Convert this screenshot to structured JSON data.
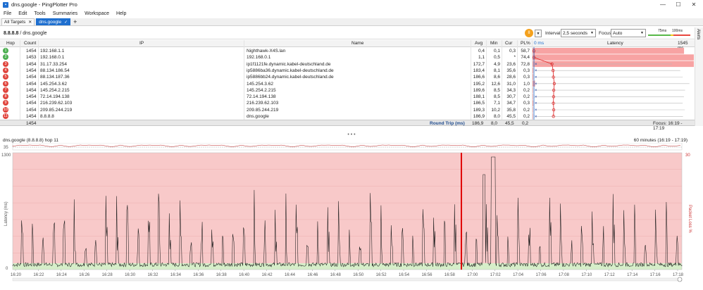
{
  "window": {
    "title": "dns.google - PingPlotter Pro",
    "minimize": "—",
    "maximize": "☐",
    "close": "✕"
  },
  "menu": [
    "File",
    "Edit",
    "Tools",
    "Summaries",
    "Workspace",
    "Help"
  ],
  "tabs": [
    {
      "label": "All Targets",
      "close": "✕"
    },
    {
      "label": "dns.google",
      "close": "✓"
    }
  ],
  "tab_add": "+",
  "toolbar": {
    "breadcrumb_ip": "8.8.8.8",
    "breadcrumb_sep": " / ",
    "breadcrumb_host": "dns.google",
    "pause_icon": "pause-icon",
    "pause_glyph": "II",
    "dropdown_glyph": "▼",
    "interval_label": "Interval",
    "interval_value": "2,5 seconds",
    "focus_label": "Focus",
    "focus_value": "Auto",
    "legend_75": "75ms",
    "legend_100": "100ms",
    "colors": {
      "green": "#58b848",
      "yellow": "#f2c71b",
      "red": "#e8463d"
    }
  },
  "alerts_label": "Alerts",
  "table": {
    "headers": {
      "hop": "Hop",
      "count": "Count",
      "ip": "IP",
      "name": "Name",
      "avg": "Avg",
      "min": "Min",
      "cur": "Cur",
      "pl": "PL%",
      "lat_left": "0 ms",
      "latency": "Latency",
      "lat_right": "1545 ms"
    },
    "rows": [
      {
        "hop": "1",
        "count": "1454",
        "ip": "192.168.1.1",
        "name": "Nighthawk-X4S.lan",
        "avg": "0,4",
        "min": "0,1",
        "cur": "0,3",
        "pl": "58,7",
        "color": "#4caf50",
        "plf": 0.587,
        "avg_ms": 0.4
      },
      {
        "hop": "2",
        "count": "1453",
        "ip": "192.168.0.1",
        "name": "192.168.0.1",
        "avg": "1,1",
        "min": "0,5",
        "cur": "*",
        "pl": "74,4",
        "color": "#4caf50",
        "plf": 0.744,
        "avg_ms": 1.1
      },
      {
        "hop": "3",
        "count": "1454",
        "ip": "31.17.33.254",
        "name": "ip1f1121fe.dynamic.kabel-deutschland.de",
        "avg": "172,7",
        "min": "4,9",
        "cur": "23,6",
        "pl": "72,8",
        "color": "#e0443c",
        "plf": 0.728,
        "avg_ms": 172.7
      },
      {
        "hop": "4",
        "count": "1454",
        "ip": "88.134.186.54",
        "name": "ip5886ba36.dynamic.kabel-deutschland.de",
        "avg": "183,4",
        "min": "8,1",
        "cur": "35,6",
        "pl": "0,3",
        "color": "#e0443c",
        "plf": 0.003,
        "avg_ms": 183.4
      },
      {
        "hop": "5",
        "count": "1454",
        "ip": "88.134.187.36",
        "name": "ip5886bb24.dynamic.kabel-deutschland.de",
        "avg": "186,6",
        "min": "8,6",
        "cur": "28,6",
        "pl": "0,3",
        "color": "#e0443c",
        "plf": 0.003,
        "avg_ms": 186.6
      },
      {
        "hop": "6",
        "count": "1454",
        "ip": "145.254.3.62",
        "name": "145.254.3.62",
        "avg": "195,2",
        "min": "12,6",
        "cur": "31,0",
        "pl": "1,0",
        "color": "#e0443c",
        "plf": 0.01,
        "avg_ms": 195.2
      },
      {
        "hop": "7",
        "count": "1454",
        "ip": "145.254.2.215",
        "name": "145.254.2.215",
        "avg": "189,6",
        "min": "8,5",
        "cur": "34,3",
        "pl": "0,2",
        "color": "#e0443c",
        "plf": 0.002,
        "avg_ms": 189.6
      },
      {
        "hop": "8",
        "count": "1454",
        "ip": "72.14.194.138",
        "name": "72.14.194.138",
        "avg": "188,1",
        "min": "8,5",
        "cur": "30,7",
        "pl": "0,2",
        "color": "#e0443c",
        "plf": 0.002,
        "avg_ms": 188.1
      },
      {
        "hop": "9",
        "count": "1454",
        "ip": "216.239.62.103",
        "name": "216.239.62.103",
        "avg": "186,5",
        "min": "7,1",
        "cur": "34,7",
        "pl": "0,3",
        "color": "#e0443c",
        "plf": 0.003,
        "avg_ms": 186.5
      },
      {
        "hop": "10",
        "count": "1454",
        "ip": "209.85.244.219",
        "name": "209.85.244.219",
        "avg": "189,3",
        "min": "10,2",
        "cur": "35,8",
        "pl": "0,2",
        "color": "#e0443c",
        "plf": 0.002,
        "avg_ms": 189.3
      },
      {
        "hop": "11",
        "count": "1454",
        "ip": "8.8.8.8",
        "name": "dns.google",
        "avg": "186,9",
        "min": "8,0",
        "cur": "45,5",
        "pl": "0,2",
        "color": "#e0443c",
        "plf": 0.002,
        "avg_ms": 186.9
      }
    ],
    "summary": {
      "count": "1454",
      "label": "Round Trip (ms)",
      "avg": "186,9",
      "min": "8,0",
      "cur": "45,5",
      "pl": "0,2",
      "focus": "Focus: 16:19 - 17:19"
    }
  },
  "splitter_glyph": "• • •",
  "graph": {
    "title": "dns.google (8.8.8.8) hop 11",
    "range": "60 minutes (16:19 - 17:19)",
    "mini_axis": "35",
    "y_max": "1300",
    "y_min": "0",
    "y_label": "Latency (ms)",
    "pl_max": "30",
    "pl_label": "Packet Loss %",
    "x_ticks": [
      "16:20",
      "16:22",
      "16:24",
      "16:26",
      "16:28",
      "16:30",
      "16:32",
      "16:34",
      "16:36",
      "16:38",
      "16:40",
      "16:42",
      "16:44",
      "16:46",
      "16:48",
      "16:50",
      "16:52",
      "16:54",
      "16:56",
      "16:58",
      "17:00",
      "17:02",
      "17:04",
      "17:06",
      "17:08",
      "17:10",
      "17:12",
      "17:14",
      "17:16",
      "17:18"
    ],
    "marker_time": "17:00",
    "colors": {
      "bad": "#f8c9c9",
      "good": "#d6eec9",
      "line": "#1a1a1a",
      "marker": "#e00000"
    }
  }
}
